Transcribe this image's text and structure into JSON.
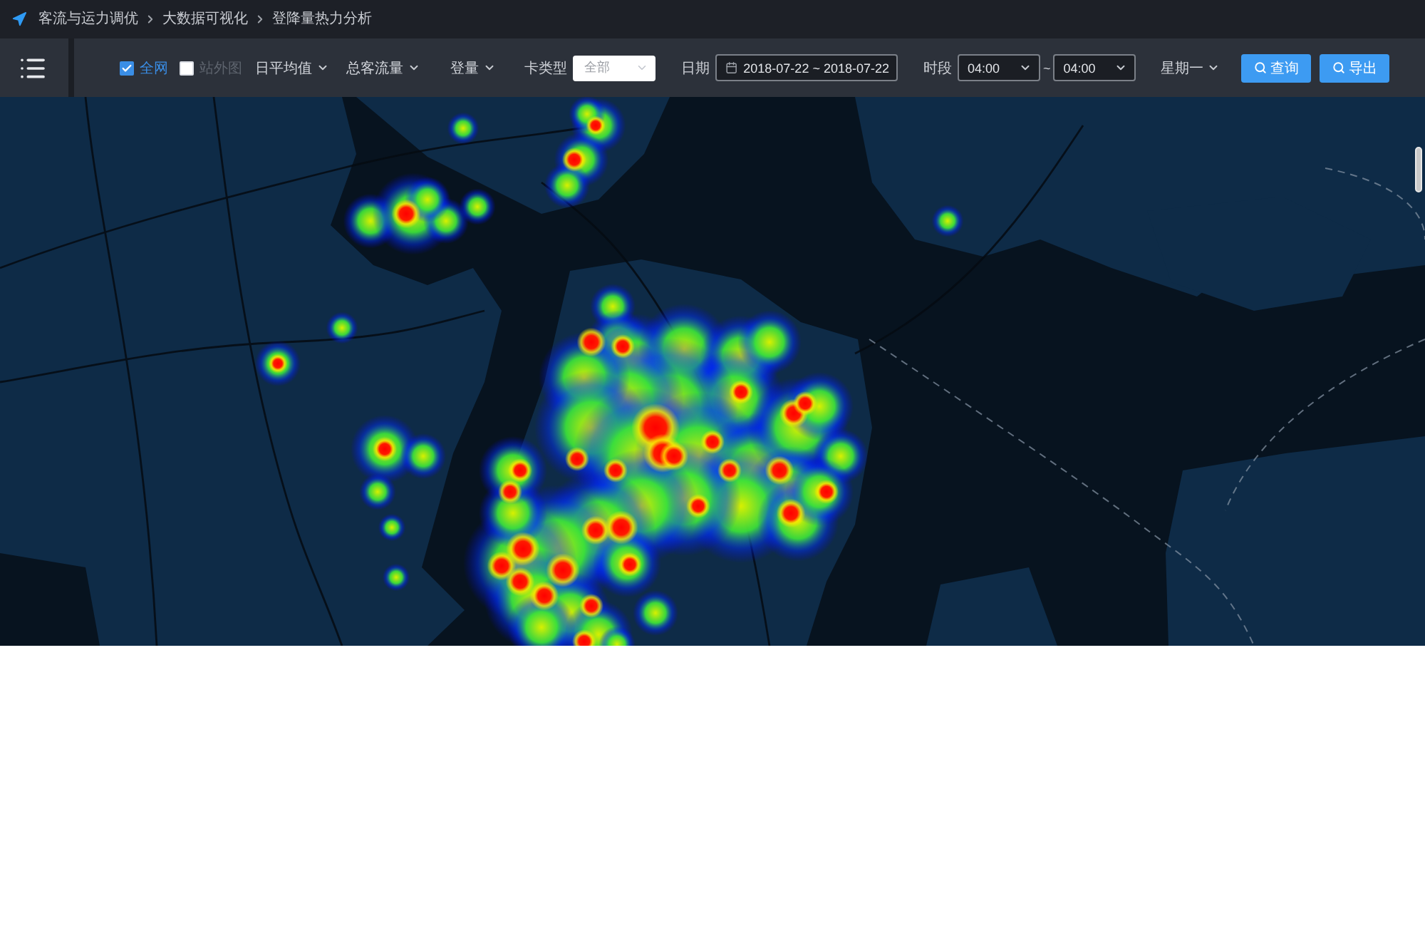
{
  "breadcrumb": [
    "客流与运力调优",
    "大数据可视化",
    "登降量热力分析"
  ],
  "toolbar": {
    "scope_options": [
      {
        "label": "全网",
        "checked": true
      },
      {
        "label": "站外图",
        "checked": false
      }
    ],
    "dropdowns": [
      {
        "label": "日平均值"
      },
      {
        "label": "总客流量"
      },
      {
        "label": "登量"
      }
    ],
    "card_type": {
      "label": "卡类型",
      "value": "全部"
    },
    "date": {
      "label": "日期",
      "value": "2018-07-22 ~ 2018-07-22"
    },
    "period": {
      "label": "时段",
      "from": "04:00",
      "separator": "~",
      "to": "04:00"
    },
    "weekday": {
      "label": "星期一"
    },
    "buttons": [
      {
        "label": "查询"
      },
      {
        "label": "导出"
      }
    ]
  }
}
